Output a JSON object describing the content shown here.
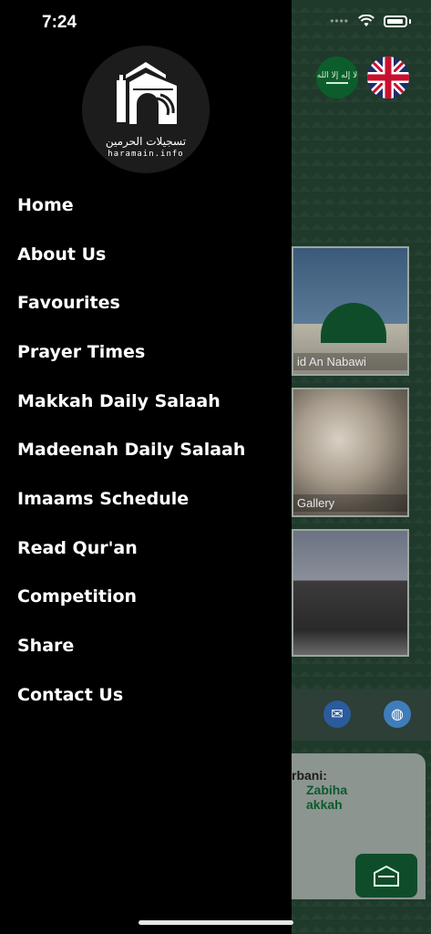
{
  "status": {
    "time": "7:24"
  },
  "logo": {
    "arabic": "تسجيلات الحرمين",
    "english": "haramain.info"
  },
  "drawer": {
    "items": [
      {
        "label": "Home",
        "name": "menu-item-home"
      },
      {
        "label": "About Us",
        "name": "menu-item-about-us"
      },
      {
        "label": "Favourites",
        "name": "menu-item-favourites"
      },
      {
        "label": "Prayer Times",
        "name": "menu-item-prayer-times"
      },
      {
        "label": "Makkah Daily Salaah",
        "name": "menu-item-makkah-daily-salaah"
      },
      {
        "label": "Madeenah Daily Salaah",
        "name": "menu-item-madeenah-daily-salaah"
      },
      {
        "label": "Imaams Schedule",
        "name": "menu-item-imaams-schedule"
      },
      {
        "label": "Read Qur'an",
        "name": "menu-item-read-quran"
      },
      {
        "label": "Competition",
        "name": "menu-item-competition"
      },
      {
        "label": "Share",
        "name": "menu-item-share"
      },
      {
        "label": "Contact Us",
        "name": "menu-item-contact-us"
      }
    ]
  },
  "background": {
    "flags": {
      "sa_text": "لا إله إلا الله"
    },
    "tiles": [
      {
        "label": "id An Nabawi"
      },
      {
        "label": "Gallery"
      },
      {
        "label": ""
      }
    ],
    "qurbani": {
      "line1": "rbani:",
      "line2": "Zabiha",
      "line3": "akkah"
    }
  },
  "colors": {
    "drawer_bg": "#000000",
    "app_green": "#1f3a2b",
    "accent_green": "#0d5a2e"
  }
}
